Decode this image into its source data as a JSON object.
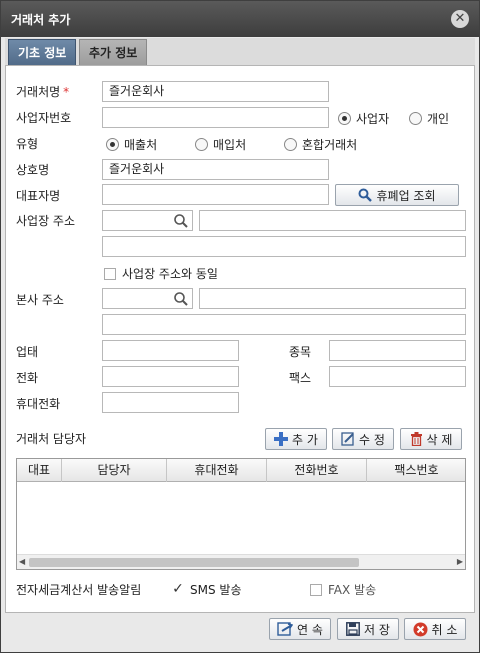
{
  "window": {
    "title": "거래처 추가"
  },
  "tabs": [
    {
      "label": "기초 정보",
      "active": true
    },
    {
      "label": "추가 정보",
      "active": false
    }
  ],
  "form": {
    "client_name": {
      "label": "거래처명",
      "required_mark": "*",
      "value": "즐거운회사"
    },
    "biz_number": {
      "label": "사업자번호",
      "value": ""
    },
    "biz_type_options": [
      {
        "label": "사업자",
        "selected": true
      },
      {
        "label": "개인",
        "selected": false
      }
    ],
    "category": {
      "label": "유형",
      "options": [
        {
          "label": "매출처",
          "selected": true
        },
        {
          "label": "매입처",
          "selected": false
        },
        {
          "label": "혼합거래처",
          "selected": false
        }
      ]
    },
    "trade_name": {
      "label": "상호명",
      "value": "즐거운회사"
    },
    "ceo_name": {
      "label": "대표자명",
      "value": ""
    },
    "closure_lookup_label": "휴폐업 조회",
    "biz_address": {
      "label": "사업장 주소",
      "zip": "",
      "address1": "",
      "address2": ""
    },
    "same_address": {
      "label": "사업장 주소와 동일",
      "checked": false
    },
    "hq_address": {
      "label": "본사 주소",
      "zip": "",
      "address1": "",
      "address2": ""
    },
    "business_type": {
      "label": "업태",
      "value": ""
    },
    "business_item": {
      "label": "종목",
      "value": ""
    },
    "phone": {
      "label": "전화",
      "value": ""
    },
    "fax": {
      "label": "팩스",
      "value": ""
    },
    "mobile": {
      "label": "휴대전화",
      "value": ""
    }
  },
  "contacts": {
    "title": "거래처 담당자",
    "add_label": "추 가",
    "edit_label": "수 정",
    "delete_label": "삭 제",
    "columns": [
      "대표",
      "담당자",
      "휴대전화",
      "전화번호",
      "팩스번호"
    ]
  },
  "notify": {
    "label": "전자세금계산서 발송알림",
    "sms": {
      "label": "SMS 발송",
      "checked": true
    },
    "fax": {
      "label": "FAX 발송",
      "checked": false
    }
  },
  "footer": {
    "continue_label": "연 속",
    "save_label": "저 장",
    "cancel_label": "취 소"
  },
  "colors": {
    "accent": "#506a88",
    "titlebar": "#4a4a4a",
    "add_icon": "#3a6fc4",
    "cancel_icon": "#d23b2a"
  }
}
